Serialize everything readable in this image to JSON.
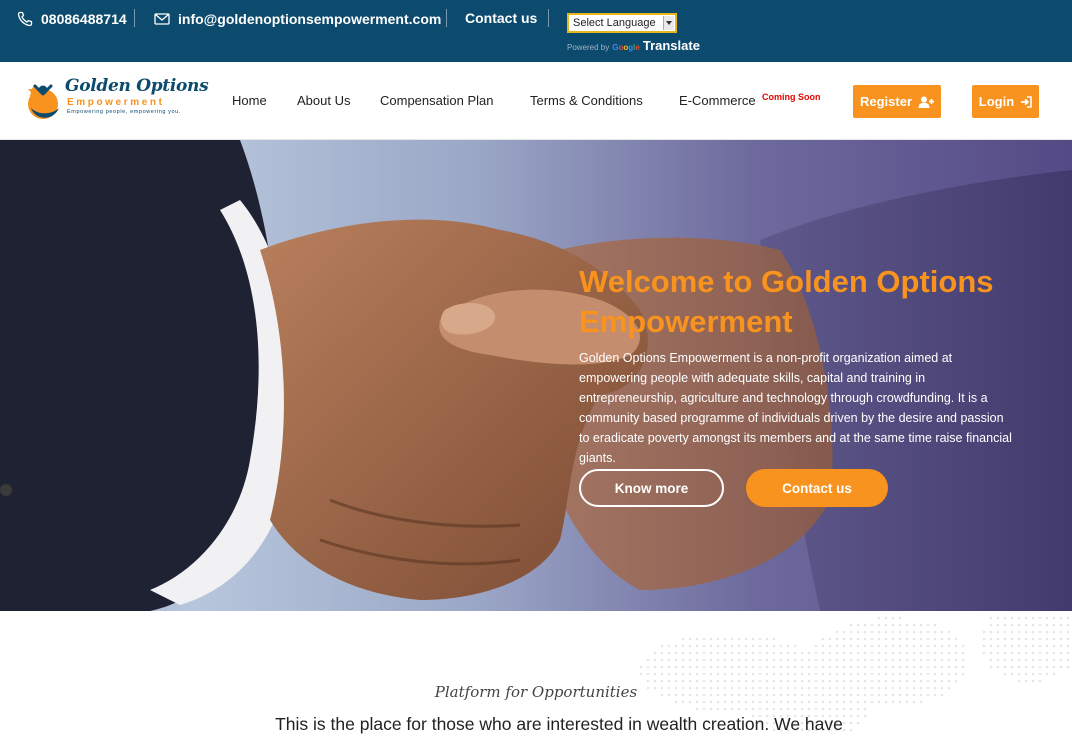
{
  "topbar": {
    "phone": "08086488714",
    "email": "info@goldenoptionsempowerment.com",
    "contact_label": "Contact us",
    "language_select": "Select Language",
    "powered_by": "Powered by",
    "google": "Google",
    "translate": "Translate",
    "icons": [
      "phone-icon",
      "mail-icon"
    ]
  },
  "logo": {
    "name_line1": "Golden Options",
    "name_line2": "Empowerment",
    "tagline": "Empowering people, empowering you."
  },
  "nav": {
    "items": [
      "Home",
      "About Us",
      "Compensation Plan",
      "Terms & Conditions",
      "E-Commerce"
    ],
    "badge": "Coming Soon",
    "register_label": "Register",
    "login_label": "Login"
  },
  "hero": {
    "title": "Welcome to Golden Options Empowerment",
    "text": "Golden Options Empowerment is a non-profit organization aimed at empowering people with adequate skills, capital and training in entrepreneurship, agriculture and technology through crowdfunding. It is a community based programme of individuals driven by the desire and passion to eradicate poverty amongst its members and at the same time raise financial giants.",
    "know_more_label": "Know more",
    "contact_label": "Contact us"
  },
  "section": {
    "subtitle": "Platform for Opportunities",
    "intro": "This is the place for those who are interested in wealth creation. We have"
  },
  "colors": {
    "topbar": "#0c4a6e",
    "accent": "#f7931e",
    "badge": "#e10600"
  }
}
